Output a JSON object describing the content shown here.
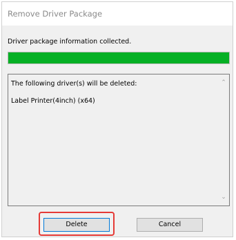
{
  "window": {
    "title": "Remove Driver Package"
  },
  "status_text": "Driver package information collected.",
  "progress": {
    "fraction": 1.0,
    "color": "#06b025"
  },
  "listbox": {
    "lines": [
      "The following driver(s) will be deleted:",
      "Label Printer(4inch) (x64)"
    ],
    "scroll_up_icon": "chevron-up-icon",
    "scroll_down_icon": "chevron-down-icon"
  },
  "buttons": {
    "delete_label": "Delete",
    "cancel_label": "Cancel"
  },
  "highlight": {
    "target": "delete-button",
    "color": "#e53935"
  }
}
